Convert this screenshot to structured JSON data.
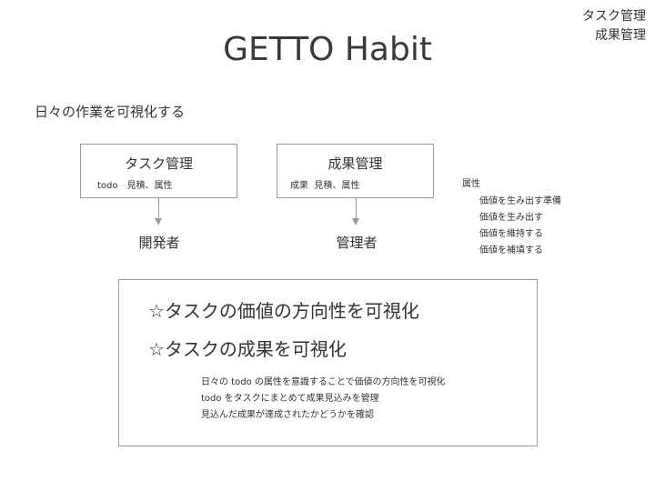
{
  "corner": {
    "line1": "タスク管理",
    "line2": "成果管理"
  },
  "title": "GETTO Habit",
  "subtitle": "日々の作業を可視化する",
  "boxes": [
    {
      "title": "タスク管理",
      "tags": "todo　見積、属性",
      "actor": "開発者"
    },
    {
      "title": "成果管理",
      "tags": "成果  見積、属性",
      "actor": "管理者"
    }
  ],
  "attributes": {
    "title": "属性",
    "items": [
      "価値を生み出す準備",
      "価値を生み出す",
      "価値を維持する",
      "価値を補填する"
    ]
  },
  "summary": {
    "star": "☆",
    "headlines": [
      "タスクの価値の方向性を可視化",
      "タスクの成果を可視化"
    ],
    "details": [
      "日々の todo の属性を意識することで価値の方向性を可視化",
      "todo をタスクにまとめて成果見込みを管理",
      "見込んだ成果が達成されたかどうかを確認"
    ]
  }
}
